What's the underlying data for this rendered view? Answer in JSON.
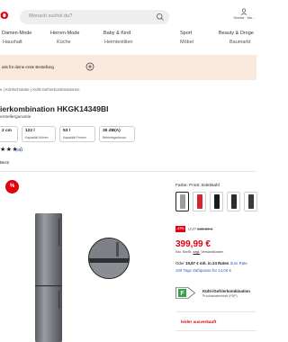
{
  "header": {
    "logo": "o",
    "search_placeholder": "Wonach suchst du?",
    "service_label": "Service · Ma..."
  },
  "nav": {
    "row1": [
      "Damen-Mode",
      "Herren-Mode",
      "Baby & Kind",
      "Sport",
      "Beauty & Droge"
    ],
    "row2": [
      "Haushalt",
      "Küche",
      "Heimtextilien",
      "Möbel",
      "Baumarkt"
    ]
  },
  "promo": {
    "text": "atis für deine erste Bestellung"
  },
  "breadcrumb": "e | Kühlschränke | Kühl-Gefrierkombinationen",
  "product": {
    "title": "ierkombination HKGK14349BI",
    "subtitle": "erstellergarantie"
  },
  "specs": [
    {
      "value": "2 cm",
      "label": ""
    },
    {
      "value": "122 l",
      "label": "Kapazität Kühlen"
    },
    {
      "value": "53 l",
      "label": "Kapazität Frieren"
    },
    {
      "value": "35 dB(A)",
      "label": "Betriebsgeräusch"
    }
  ],
  "rating": {
    "stars": "★★★☆",
    "count": "(66)"
  },
  "energy_filter": "Besti",
  "sale_badge": "%",
  "variants": {
    "label": "Farbe: Front: Edelstahl",
    "colors": [
      "#2b2b2b",
      "#d8232a",
      "#1a1a1a",
      "#4a4a4a",
      "#3a3a3a"
    ]
  },
  "pricing": {
    "discount": "-27%",
    "uvp_prefix": "UVP",
    "uvp_old": "549,00 €",
    "price": "399,99 €",
    "vat_prefix": "inkl. MwSt.",
    "vat_link": "zzgl.",
    "vat_suffix": "Versandkosten",
    "financing_prefix": "Oder",
    "financing_bold": "19,87 € mtl. in 24 Raten",
    "financing_link": "Zum Rate",
    "return": "100 Tage Zahlpause für 14,00 €"
  },
  "energy": {
    "class": "F",
    "title": "Kühl-/Gefrierkombination",
    "sheet": "Produktdatenblatt (PDF)"
  },
  "availability": "leider ausverkauft"
}
